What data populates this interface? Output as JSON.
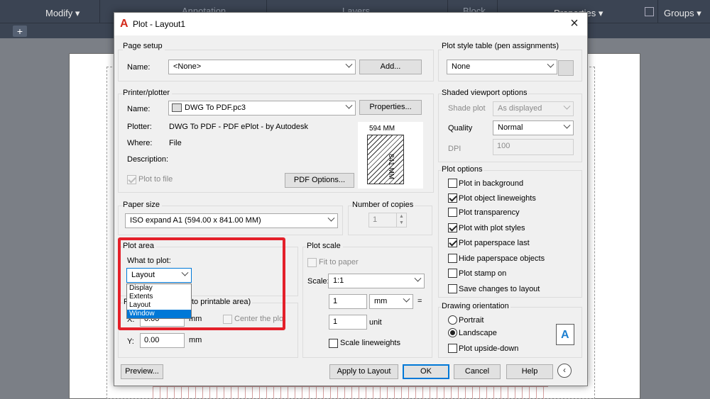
{
  "ribbon": {
    "modify": "Modify ▾",
    "annotation": "Annotation",
    "layers": "Layers",
    "block": "Block",
    "properties": "Properties ▾",
    "groups": "Groups ▾"
  },
  "dialog": {
    "title": "Plot - Layout1",
    "page_setup": {
      "group": "Page setup",
      "name_label": "Name:",
      "name_value": "<None>",
      "add_button": "Add..."
    },
    "printer": {
      "group": "Printer/plotter",
      "name_label": "Name:",
      "name_value": "DWG To PDF.pc3",
      "properties_button": "Properties...",
      "plotter_label": "Plotter:",
      "plotter_value": "DWG To PDF - PDF ePlot - by Autodesk",
      "where_label": "Where:",
      "where_value": "File",
      "description_label": "Description:",
      "plot_to_file": "Plot to file",
      "pdf_options_button": "PDF Options...",
      "preview_width": "594 MM",
      "preview_height": "841 MM"
    },
    "paper_size": {
      "group": "Paper size",
      "value": "ISO expand A1 (594.00 x 841.00 MM)"
    },
    "copies": {
      "group": "Number of copies",
      "value": "1"
    },
    "plot_area": {
      "group": "Plot area",
      "what_label": "What to plot:",
      "selected": "Layout",
      "options": [
        "Display",
        "Extents",
        "Layout",
        "Window"
      ],
      "highlighted": "Window"
    },
    "plot_offset": {
      "group_partial": "to printable area)",
      "x_label": "X:",
      "x_value": "0.00",
      "x_unit": "mm",
      "center": "Center the plot",
      "y_label": "Y:",
      "y_value": "0.00",
      "y_unit": "mm"
    },
    "plot_scale": {
      "group": "Plot scale",
      "fit": "Fit to paper",
      "scale_label": "Scale:",
      "scale_value": "1:1",
      "num": "1",
      "unit_value": "mm",
      "eq": "=",
      "den": "1",
      "unit_label": "unit",
      "scale_lw": "Scale lineweights"
    },
    "plot_style": {
      "group": "Plot style table (pen assignments)",
      "value": "None"
    },
    "shaded": {
      "group": "Shaded viewport options",
      "shade_label": "Shade plot",
      "shade_value": "As displayed",
      "quality_label": "Quality",
      "quality_value": "Normal",
      "dpi_label": "DPI",
      "dpi_value": "100"
    },
    "plot_options": {
      "group": "Plot options",
      "items": [
        {
          "label": "Plot in background",
          "checked": false
        },
        {
          "label": "Plot object lineweights",
          "checked": true
        },
        {
          "label": "Plot transparency",
          "checked": false
        },
        {
          "label": "Plot with plot styles",
          "checked": true
        },
        {
          "label": "Plot paperspace last",
          "checked": true
        },
        {
          "label": "Hide paperspace objects",
          "checked": false
        },
        {
          "label": "Plot stamp on",
          "checked": false
        },
        {
          "label": "Save changes to layout",
          "checked": false
        }
      ]
    },
    "orientation": {
      "group": "Drawing orientation",
      "portrait": "Portrait",
      "landscape": "Landscape",
      "upside": "Plot upside-down",
      "icon": "A"
    },
    "buttons": {
      "preview": "Preview...",
      "apply": "Apply to Layout",
      "ok": "OK",
      "cancel": "Cancel",
      "help": "Help",
      "back": "‹"
    }
  }
}
